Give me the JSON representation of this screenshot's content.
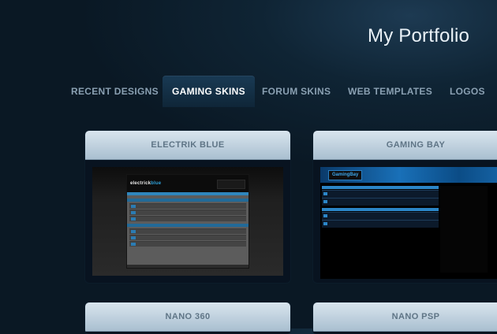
{
  "header": {
    "title": "My Portfolio"
  },
  "nav": {
    "tabs": [
      {
        "label": "RECENT DESIGNS",
        "active": false
      },
      {
        "label": "GAMING SKINS",
        "active": true
      },
      {
        "label": "FORUM SKINS",
        "active": false
      },
      {
        "label": "WEB TEMPLATES",
        "active": false
      },
      {
        "label": "LOGOS",
        "active": false
      }
    ]
  },
  "portfolio": {
    "items": [
      {
        "title": "ELECTRIK BLUE",
        "logo_text": "electrick",
        "logo_accent": "blue"
      },
      {
        "title": "GAMING BAY",
        "logo_text": "GamingBay"
      },
      {
        "title": "NANO 360"
      },
      {
        "title": "NANO PSP"
      }
    ]
  },
  "colors": {
    "background": "#0f2434",
    "accent_blue": "#2fa3dc",
    "card_caption": "#c4d5e2",
    "tab_inactive": "#8aa0b2",
    "tab_active": "#ffffff"
  }
}
